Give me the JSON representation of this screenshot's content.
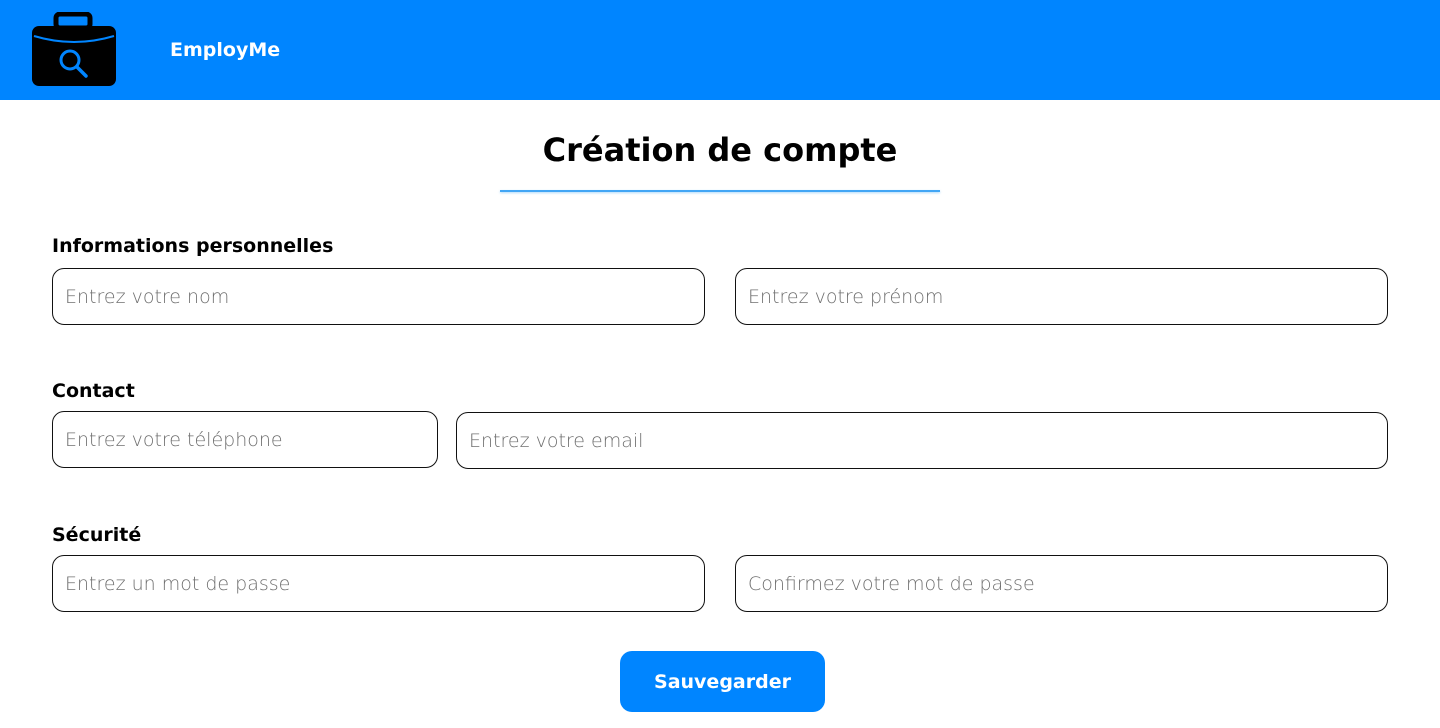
{
  "header": {
    "brand": "EmployMe",
    "logo_icon": "briefcase-search-icon",
    "background_color": "#0085ff"
  },
  "page": {
    "title": "Création de compte",
    "accent_color": "#42a6f5"
  },
  "sections": {
    "personal": {
      "label": "Informations personnelles",
      "last_name_placeholder": "Entrez votre nom",
      "first_name_placeholder": "Entrez votre prénom"
    },
    "contact": {
      "label": "Contact",
      "phone_placeholder": "Entrez votre téléphone",
      "email_placeholder": "Entrez votre email"
    },
    "security": {
      "label": "Sécurité",
      "password_placeholder": "Entrez un mot de passe",
      "confirm_password_placeholder": "Confirmez votre mot de passe"
    }
  },
  "actions": {
    "save_label": "Sauvegarder"
  }
}
